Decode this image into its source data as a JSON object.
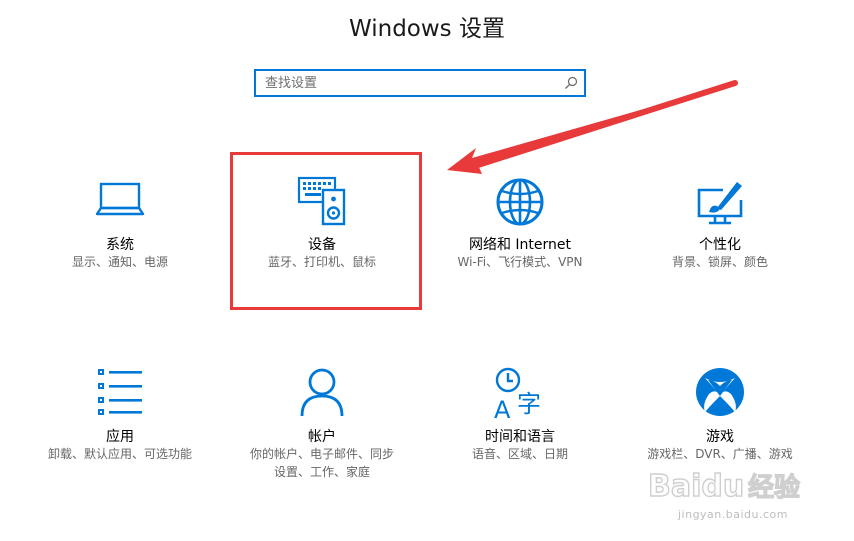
{
  "window": {
    "title": "Windows 设置"
  },
  "search": {
    "placeholder": "查找设置"
  },
  "categories": [
    {
      "name": "系统",
      "desc": "显示、通知、电源",
      "icon": "laptop-icon"
    },
    {
      "name": "设备",
      "desc": "蓝牙、打印机、鼠标",
      "icon": "devices-icon"
    },
    {
      "name": "网络和 Internet",
      "desc": "Wi-Fi、飞行模式、VPN",
      "icon": "globe-icon"
    },
    {
      "name": "个性化",
      "desc": "背景、锁屏、颜色",
      "icon": "paint-brush-icon"
    },
    {
      "name": "应用",
      "desc": "卸载、默认应用、可选功能",
      "icon": "apps-list-icon"
    },
    {
      "name": "帐户",
      "desc": "你的帐户、电子邮件、同步\n设置、工作、家庭",
      "icon": "person-icon"
    },
    {
      "name": "时间和语言",
      "desc": "语音、区域、日期",
      "icon": "time-language-icon"
    },
    {
      "name": "游戏",
      "desc": "游戏栏、DVR、广播、游戏",
      "icon": "xbox-icon"
    }
  ],
  "colors": {
    "accent": "#0078d7",
    "annotation": "#e83a3a"
  },
  "watermark": {
    "brand": "Baidu经验",
    "url": "jingyan.baidu.com"
  }
}
